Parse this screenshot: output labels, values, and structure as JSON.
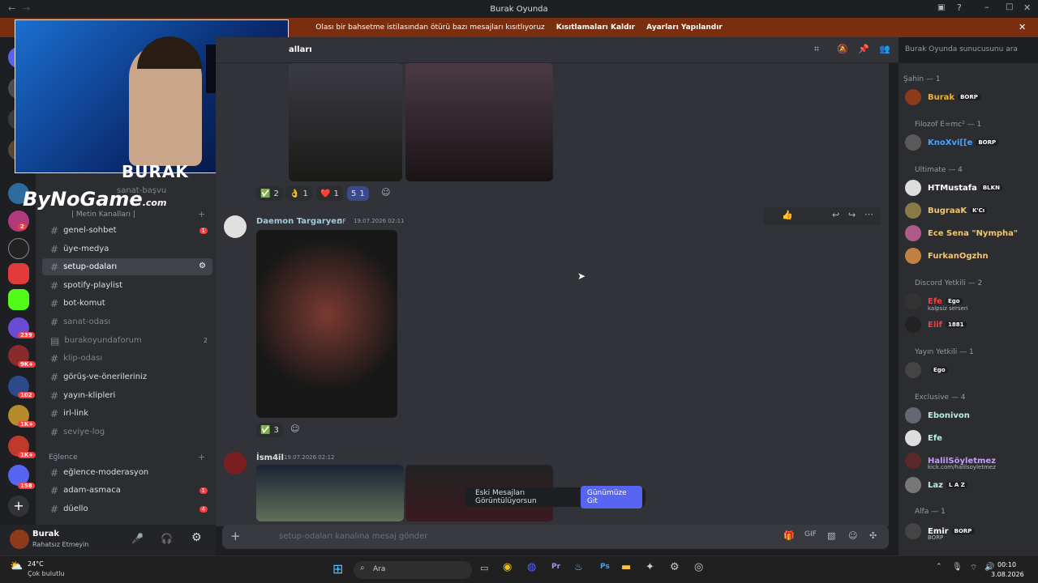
{
  "window": {
    "title": "Burak Oyunda"
  },
  "banner": {
    "text": "Olası bir bahsetme istilasından ötürü bazı mesajları kısıtlıyoruz",
    "action1": "Kısıtlamaları Kaldır",
    "action2": "Ayarları Yapılandır"
  },
  "overlay": {
    "name": "BURAK",
    "watermark": "ByNoGame",
    "watermark_suffix": ".com"
  },
  "guild_badges": [
    "2",
    "239",
    "9K+",
    "102",
    "1K+",
    "1K+",
    "158"
  ],
  "channels": {
    "partial_top": "sanat-başvu",
    "category_metin": "| Metin Kanalları |",
    "items": [
      {
        "name": "genel-sohbet",
        "badge": "1"
      },
      {
        "name": "üye-medya",
        "badge": ""
      },
      {
        "name": "setup-odaları",
        "badge": ""
      },
      {
        "name": "spotify-playlist",
        "badge": ""
      },
      {
        "name": "bot-komut",
        "badge": ""
      },
      {
        "name": "sanat-odası",
        "badge": ""
      },
      {
        "name": "burakoyundaforum",
        "badge": "2"
      },
      {
        "name": "klip-odası",
        "badge": ""
      },
      {
        "name": "görüş-ve-önerileriniz",
        "badge": ""
      },
      {
        "name": "yayın-klipleri",
        "badge": ""
      },
      {
        "name": "irl-link",
        "badge": ""
      },
      {
        "name": "seviye-log",
        "badge": ""
      }
    ],
    "category_eglence": "Eğlence",
    "eglence_items": [
      {
        "name": "eğlence-moderasyon",
        "badge": ""
      },
      {
        "name": "adam-asmaca",
        "badge": "1"
      },
      {
        "name": "düello",
        "badge": "4"
      }
    ]
  },
  "user": {
    "name": "Burak",
    "status": "Rahatsız Etmeyin"
  },
  "chat": {
    "header": "alları",
    "reactions1": [
      {
        "emoji": "✅",
        "count": "2"
      },
      {
        "emoji": "👌",
        "count": "1"
      },
      {
        "emoji": "❤️",
        "count": "1"
      },
      {
        "emoji": "5",
        "count": "1"
      }
    ],
    "msg2": {
      "author": "Daemon Targaryen",
      "tag": "GF",
      "time": "19.07.2026 02:11",
      "reaction": {
        "emoji": "✅",
        "count": "3"
      }
    },
    "msg3": {
      "author": "İsm4il",
      "time": "19.07.2026 02:12"
    },
    "toast": {
      "text": "Eski Mesajları Görüntülüyorsun",
      "button": "Günümüze Git"
    },
    "composer_placeholder": "setup-odaları kanalına mesaj gönder"
  },
  "search": {
    "placeholder": "Burak Oyunda sunucusunu ara"
  },
  "members": {
    "groups": [
      {
        "label": "Şahin — 1"
      },
      {
        "label": "Filozof E=mc² — 1"
      },
      {
        "label": "Ultimate — 4"
      },
      {
        "label": "Discord Yetkili — 2"
      },
      {
        "label": "Yayın Yetkili — 1"
      },
      {
        "label": "Exclusive — 4"
      },
      {
        "label": "Alfa — 1"
      }
    ],
    "list": [
      {
        "name": "Burak",
        "tag": "BORP",
        "color": "#f0b232"
      },
      {
        "name": "KnoXvi[[e",
        "tag": "BORP",
        "color": "#4ea3ff"
      },
      {
        "name": "HTMustafa",
        "tag": "BLKN",
        "color": "#ffffff"
      },
      {
        "name": "BugraaK",
        "tag": "K'Cı",
        "color": "#f0c674"
      },
      {
        "name": "Ece Sena \"Nympha\"",
        "tag": "",
        "color": "#f0c674"
      },
      {
        "name": "FurkanOgzhn",
        "tag": "",
        "color": "#f0c674"
      },
      {
        "name": "Efe",
        "tag": "Ego",
        "color": "#f23f43",
        "sub": "kalpsiz serseri"
      },
      {
        "name": "Elif",
        "tag": "1881",
        "color": "#f23f43"
      },
      {
        "name": "",
        "tag": "Ego",
        "color": "#6b5bd6"
      },
      {
        "name": "Ebonivon",
        "tag": "",
        "color": "#b5f0e8"
      },
      {
        "name": "Efe",
        "tag": "",
        "color": "#b5f0e8"
      },
      {
        "name": "HalilSöyletmez",
        "tag": "",
        "color": "#c89bff",
        "sub": "kick.com/halilsoyletmez"
      },
      {
        "name": "Laz",
        "tag": "L A Z",
        "color": "#b5f0e8"
      },
      {
        "name": "Emir",
        "tag": "BORP",
        "color": "#ffffff",
        "sub": "BORP"
      }
    ]
  },
  "taskbar": {
    "weather_temp": "24°C",
    "weather_desc": "Çok bulutlu",
    "search": "Ara",
    "time": "00:10",
    "date": "3.08.2026"
  }
}
